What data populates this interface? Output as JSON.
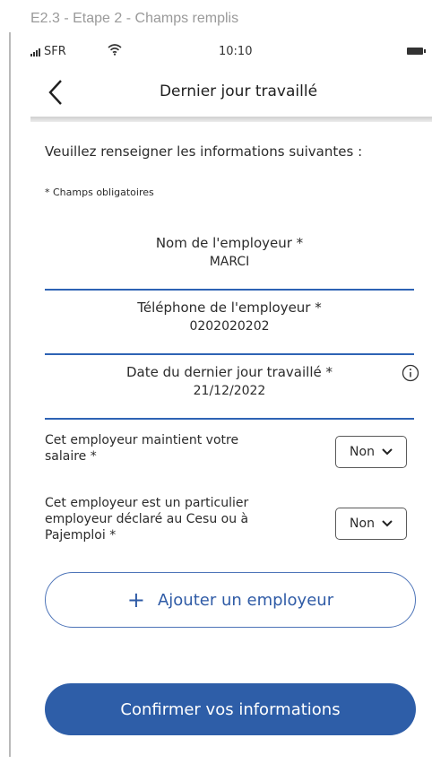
{
  "caption": "E2.3 - Etape 2 - Champs remplis",
  "status_bar": {
    "carrier": "SFR",
    "time": "10:10"
  },
  "nav": {
    "title": "Dernier jour travaillé"
  },
  "form": {
    "intro": "Veuillez renseigner les informations suivantes :",
    "required_note": "* Champs obligatoires",
    "fields": [
      {
        "label": "Nom de l'employeur *",
        "value": "MARCI"
      },
      {
        "label": "Téléphone de l'employeur *",
        "value": "0202020202"
      },
      {
        "label": "Date du dernier jour travaillé *",
        "value": "21/12/2022"
      }
    ],
    "questions": [
      {
        "text": "Cet employeur maintient votre salaire *",
        "selected": "Non"
      },
      {
        "text": "Cet employeur est un particulier employeur déclaré au Cesu ou à Pajemploi *",
        "selected": "Non"
      }
    ],
    "add_employer_label": "Ajouter un employeur",
    "add_employer_icon": "+",
    "confirm_label": "Confirmer vos informations"
  },
  "colors": {
    "accent": "#2e5ea8",
    "underline": "#2e63b4"
  }
}
